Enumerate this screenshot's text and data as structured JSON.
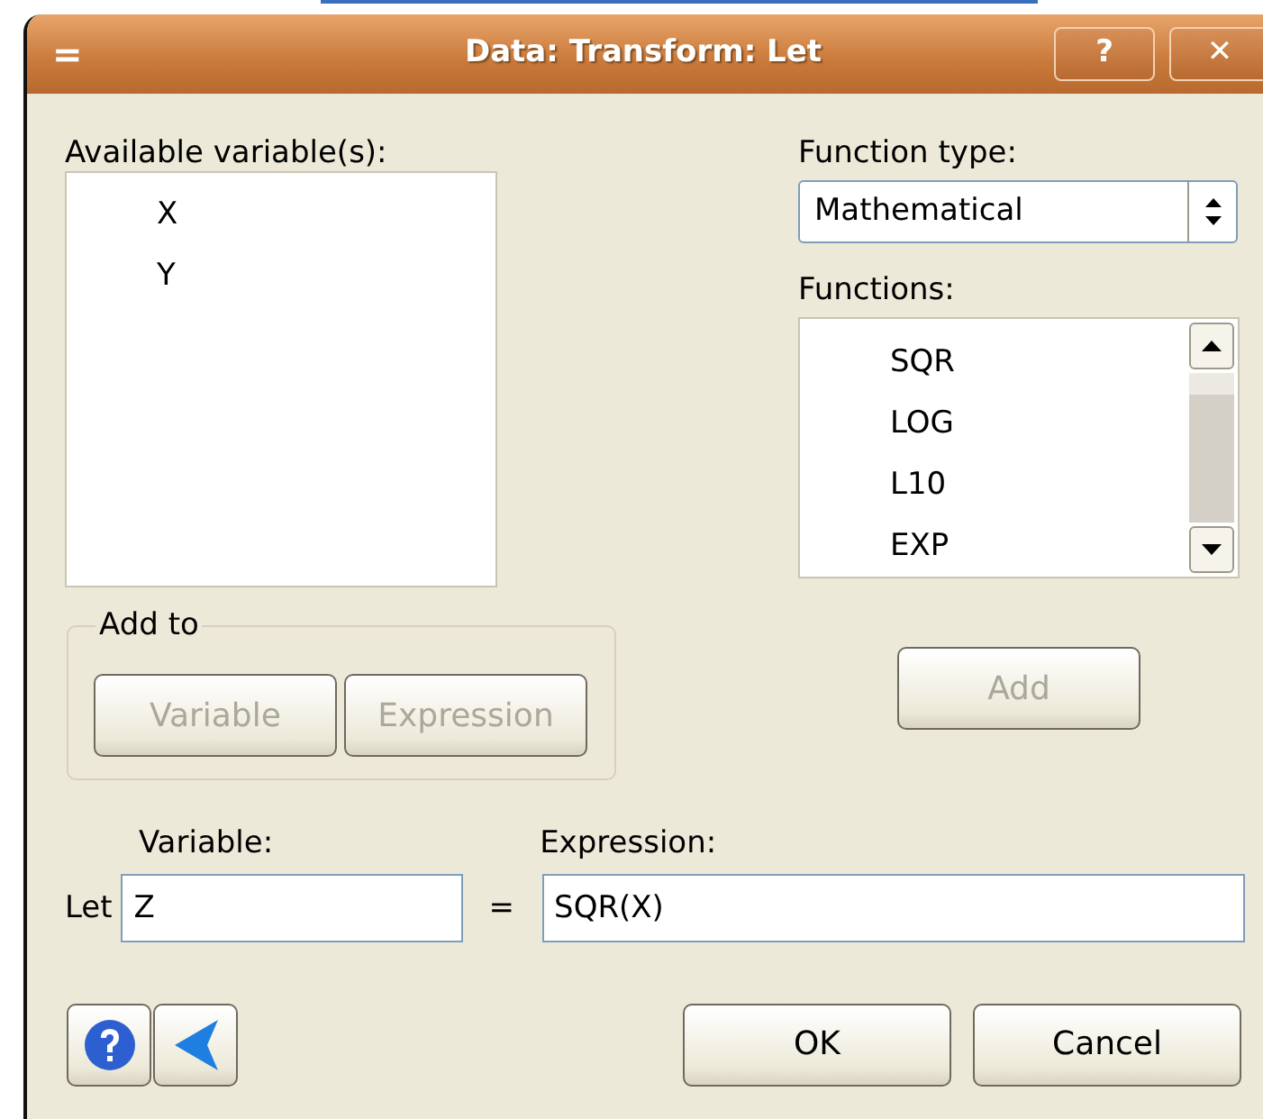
{
  "window": {
    "title": "Data: Transform: Let",
    "menu_glyph": "=",
    "title_buttons": [
      {
        "label": "?"
      },
      {
        "label": "✕"
      }
    ]
  },
  "variables": {
    "label": "Available variable(s):",
    "items": [
      {
        "text": "X",
        "selected": false
      },
      {
        "text": "Y",
        "selected": false
      }
    ]
  },
  "function_type": {
    "label": "Function type:",
    "value": "Mathematical"
  },
  "functions": {
    "label": "Functions:",
    "items": [
      {
        "text": "SQR",
        "selected": false
      },
      {
        "text": "LOG",
        "selected": false
      },
      {
        "text": "L10",
        "selected": false
      },
      {
        "text": "EXP",
        "selected": false
      }
    ]
  },
  "add_to": {
    "label": "Add to",
    "buttons": [
      {
        "label": "Variable",
        "disabled": true
      },
      {
        "label": "Expression",
        "disabled": true
      }
    ]
  },
  "add_button": {
    "label": "Add",
    "disabled": true
  },
  "let_row": {
    "let_label": "Let",
    "variable_label": "Variable:",
    "variable_value": "Z",
    "equals": "=",
    "expression_label": "Expression:",
    "expression_value": "SQR(X)"
  },
  "footer": {
    "icon_buttons": [
      {
        "kind": "help"
      },
      {
        "kind": "back"
      }
    ],
    "buttons": [
      {
        "label": "OK",
        "disabled": false
      },
      {
        "label": "Cancel",
        "disabled": false
      }
    ]
  }
}
